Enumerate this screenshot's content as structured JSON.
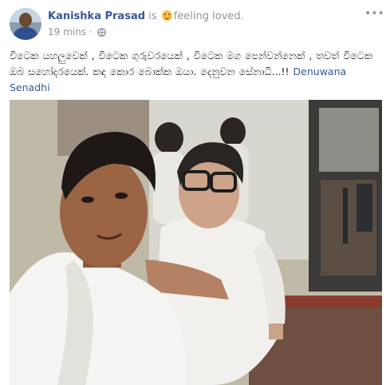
{
  "post": {
    "author": "Kanishka Prasad",
    "connector": "is",
    "feeling": "feeling loved.",
    "time": "19 mins",
    "separator": "·",
    "body": "විටෙක යහලුවෙක් , විටෙක ගුරුවරයෙක් , විටෙක මග පෙන්වන්නෙක් , තවත් විටෙක ඔබ සහෝදරයෙක්. කඳ කොර බොක්ක ඔයා. දෙනුවන සේනාධි...!!",
    "tagged_friend": "Denuwana Senadhi"
  },
  "icons": [
    "avatar",
    "emoji-loved-icon",
    "globe-icon",
    "more-options-icon"
  ],
  "colors": {
    "link": "#365899",
    "meta": "#90949c",
    "text": "#1d2129"
  }
}
